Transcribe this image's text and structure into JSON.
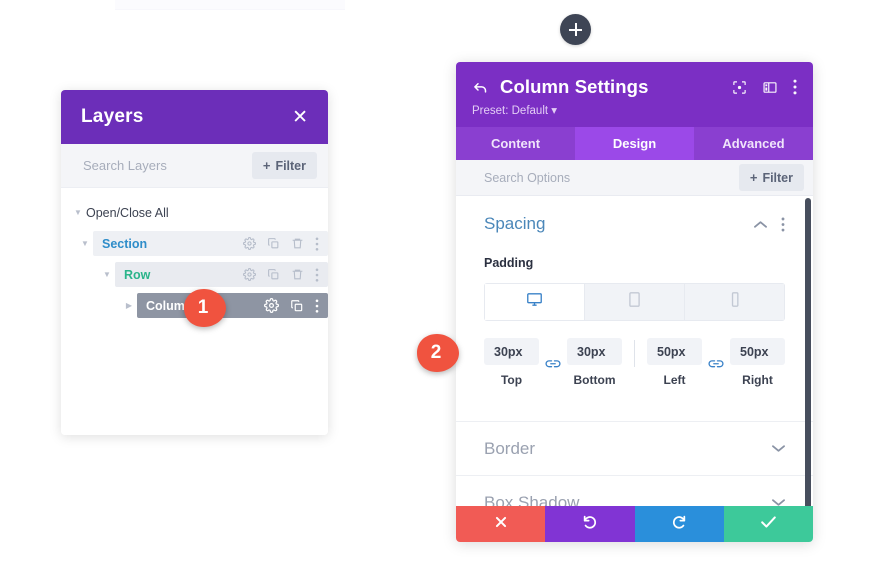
{
  "canvas": {
    "add_button": {
      "icon": "plus-icon",
      "label": "+"
    }
  },
  "layers_panel": {
    "title": "Layers",
    "close_icon": "close-icon",
    "search": {
      "placeholder": "Search Layers"
    },
    "filter_button": {
      "label": "Filter",
      "icon": "plus-icon"
    },
    "open_close_all": {
      "label": "Open/Close All",
      "caret": "caret-down-icon"
    },
    "tree": [
      {
        "label": "Section",
        "caret": "caret-down-icon",
        "actions": [
          "gear-icon",
          "duplicate-icon",
          "trash-icon",
          "more-vertical-icon"
        ]
      },
      {
        "label": "Row",
        "caret": "caret-down-icon",
        "actions": [
          "gear-icon",
          "duplicate-icon",
          "trash-icon",
          "more-vertical-icon"
        ]
      },
      {
        "label": "Column",
        "caret": "caret-right-icon",
        "actions": [
          "gear-icon",
          "duplicate-icon",
          "more-vertical-icon"
        ]
      }
    ],
    "colors": {
      "header_bg": "#6c2eb9",
      "section_text": "#2f8dc9",
      "row_text": "#2bb48a",
      "column_row_bg": "#8e95a3"
    }
  },
  "settings_panel": {
    "back_icon": "back-arrow-icon",
    "title": "Column Settings",
    "preset": "Preset: Default",
    "header_icons": [
      "fullscreen-icon",
      "layout-view-icon",
      "more-vertical-icon"
    ],
    "tabs": [
      {
        "label": "Content",
        "active": false
      },
      {
        "label": "Design",
        "active": true
      },
      {
        "label": "Advanced",
        "active": false
      }
    ],
    "search": {
      "placeholder": "Search Options"
    },
    "filter_button": {
      "label": "Filter",
      "icon": "plus-icon"
    },
    "sections": [
      {
        "label": "Spacing",
        "state": "open",
        "chevron": "chevron-up-icon",
        "more": "more-vertical-icon"
      },
      {
        "label": "Border",
        "state": "closed",
        "chevron": "chevron-down-icon"
      },
      {
        "label": "Box Shadow",
        "state": "closed",
        "chevron": "chevron-down-icon"
      }
    ],
    "spacing": {
      "field_label": "Padding",
      "device_tabs": [
        {
          "icon": "desktop-icon",
          "active": true
        },
        {
          "icon": "tablet-icon",
          "active": false
        },
        {
          "icon": "phone-icon",
          "active": false
        }
      ],
      "values": [
        {
          "value": "30px",
          "caption": "Top"
        },
        {
          "value": "30px",
          "caption": "Bottom"
        },
        {
          "value": "50px",
          "caption": "Left"
        },
        {
          "value": "50px",
          "caption": "Right"
        }
      ],
      "link_icon": "link-sync-icon"
    },
    "footer": [
      {
        "name": "cancel",
        "icon": "x-icon",
        "color": "#f15b55"
      },
      {
        "name": "undo",
        "icon": "undo-icon",
        "color": "#8134d4"
      },
      {
        "name": "redo",
        "icon": "redo-icon",
        "color": "#2a8fdb"
      },
      {
        "name": "save",
        "icon": "check-icon",
        "color": "#3dc99a"
      }
    ],
    "colors": {
      "header_bg": "#7b2fc4",
      "tabbar_bg": "#8a3fd0",
      "active_tab_bg": "#9b49e8",
      "section_open_title": "#4b87b9"
    }
  },
  "callouts": [
    {
      "number": "1",
      "color": "#f0533f"
    },
    {
      "number": "2",
      "color": "#f0533f"
    }
  ]
}
